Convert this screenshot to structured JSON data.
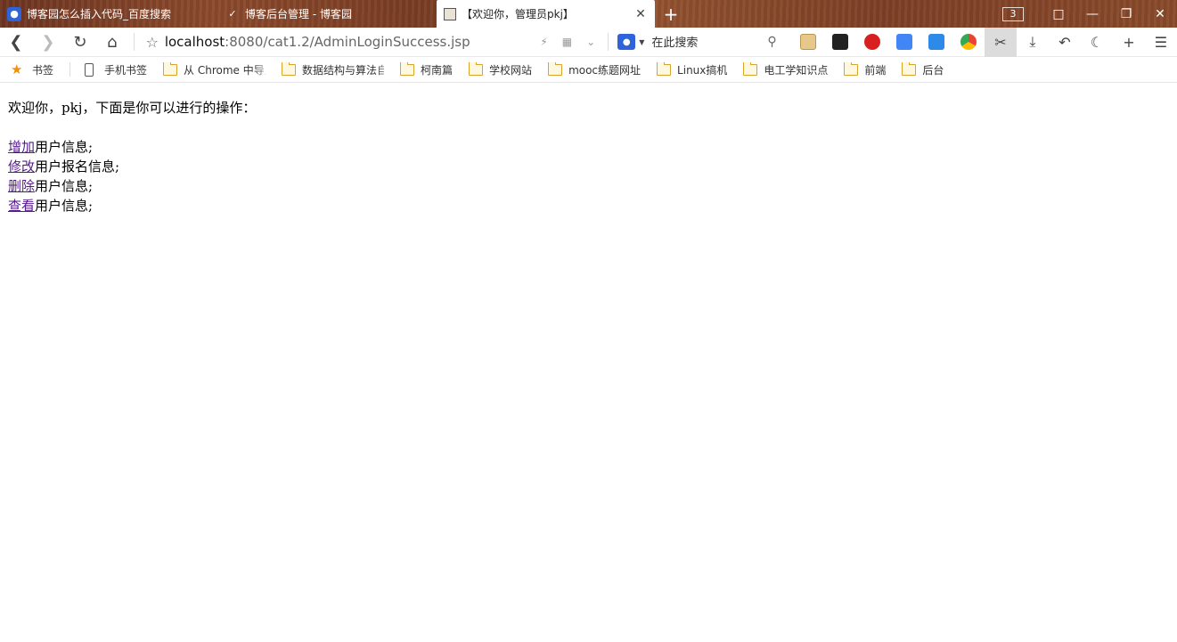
{
  "tabs": [
    {
      "title": "博客园怎么插入代码_百度搜索",
      "icon": "baidu-paw-icon",
      "active": false
    },
    {
      "title": "博客后台管理 - 博客园",
      "icon": "cnblogs-icon",
      "active": false
    },
    {
      "title": "【欢迎你，管理员pkj】",
      "icon": "page-icon",
      "active": true
    }
  ],
  "window": {
    "tab_count": "3"
  },
  "address": {
    "host": "localhost",
    "rest": ":8080/cat1.2/AdminLoginSuccess.jsp"
  },
  "search": {
    "placeholder": "在此搜索"
  },
  "bookmarks": {
    "root": "书签",
    "mobile": "手机书签",
    "items": [
      "从 Chrome 中导入",
      "数据结构与算法自学",
      "柯南篇",
      "学校网站",
      "mooc练题网址",
      "Linux搞机",
      "电工学知识点",
      "前端",
      "后台"
    ]
  },
  "content": {
    "greeting": "欢迎你，pkj，下面是你可以进行的操作：",
    "actions": [
      {
        "link": "增加",
        "text": "用户信息;"
      },
      {
        "link": "修改",
        "text": "用户报名信息;"
      },
      {
        "link": "删除",
        "text": "用户信息;"
      },
      {
        "link": "查看",
        "text": "用户信息;"
      }
    ]
  },
  "colors": {
    "link_visited": "#551a8b",
    "bookmark_star": "#f0900d",
    "folder": "#d9a32e"
  }
}
